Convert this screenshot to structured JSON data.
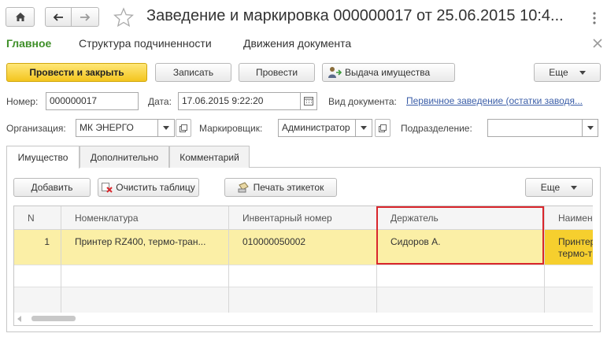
{
  "window": {
    "title": "Заведение и маркировка 000000017 от 25.06.2015 10:4...",
    "more_icon": "more-vertical-icon",
    "close_icon": "close-icon"
  },
  "sections": [
    "Главное",
    "Структура подчиненности",
    "Движения документа"
  ],
  "toolbar": {
    "post_and_close": "Провести и закрыть",
    "save": "Записать",
    "post": "Провести",
    "issue_property": "Выдача имущества",
    "more": "Еще"
  },
  "form": {
    "number_label": "Номер:",
    "number_value": "000000017",
    "date_label": "Дата:",
    "date_value": "17.06.2015  9:22:20",
    "doc_type_label": "Вид документа:",
    "doc_type_value": "Первичное заведение (остатки заводя...",
    "org_label": "Организация:",
    "org_value": "МК ЭНЕРГО",
    "marker_label": "Маркировщик:",
    "marker_value": "Администратор",
    "division_label": "Подразделение:",
    "division_value": ""
  },
  "tabs": [
    "Имущество",
    "Дополнительно",
    "Комментарий"
  ],
  "table_toolbar": {
    "add": "Добавить",
    "clear": "Очистить таблицу",
    "print_labels": "Печать этикеток",
    "more": "Еще"
  },
  "table": {
    "columns": [
      "N",
      "Номенклатура",
      "Инвентарный номер",
      "Держатель",
      "Наимен"
    ],
    "rows": [
      {
        "n": "1",
        "nomenclature": "Принтер RZ400, термо-тран...",
        "inventory": "010000050002",
        "holder": "Сидоров А.",
        "name_line1": "Принтер",
        "name_line2": "термо-т"
      }
    ]
  },
  "colors": {
    "accent_green": "#3e8f28",
    "primary_yellow": "#f6cf2e",
    "selected_row": "#fbefa6",
    "highlight_border": "#d9262c",
    "link": "#3b5ea8"
  }
}
